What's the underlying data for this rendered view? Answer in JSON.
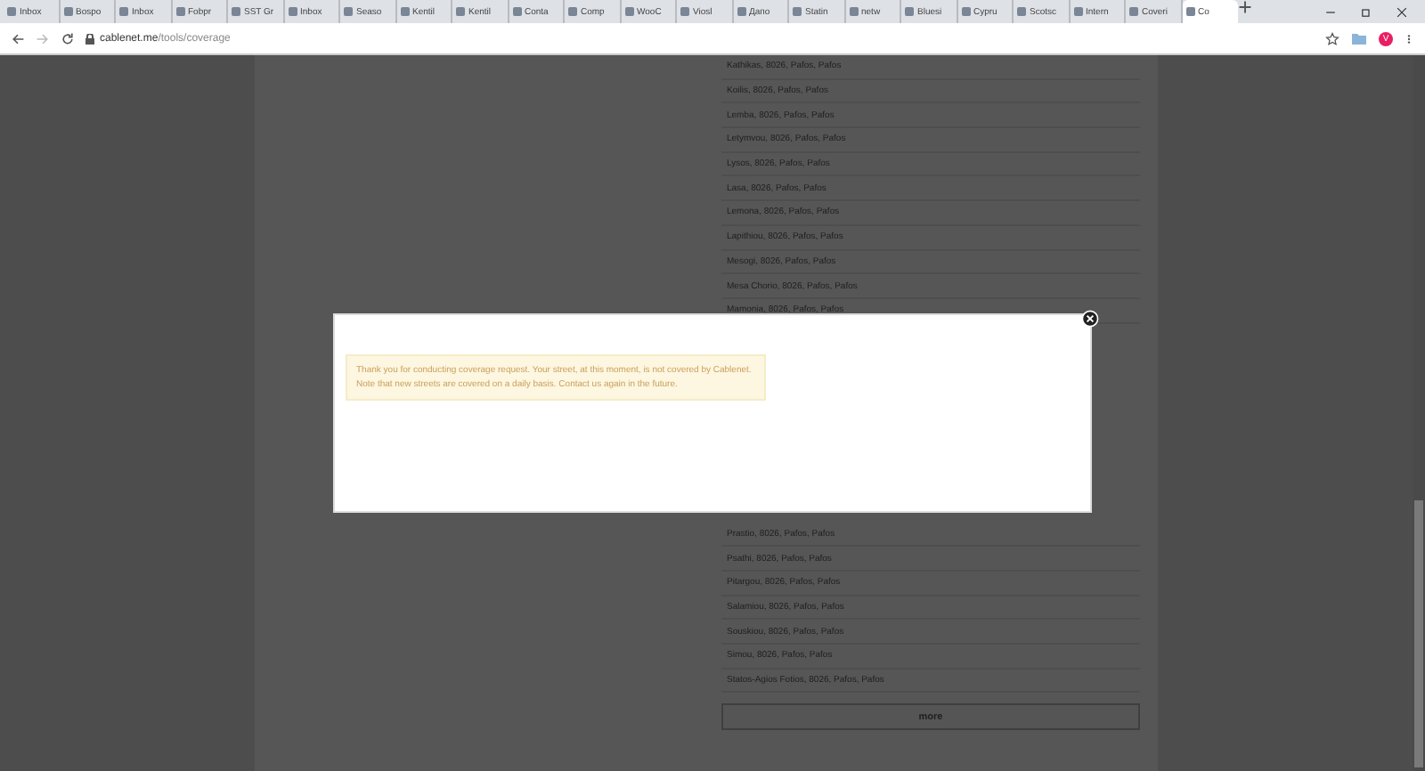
{
  "browser": {
    "tabs": [
      {
        "title": "Inbox",
        "selected": false
      },
      {
        "title": "Bospo",
        "selected": false
      },
      {
        "title": "Inbox",
        "selected": false
      },
      {
        "title": "Fobpr",
        "selected": false
      },
      {
        "title": "SST Gr",
        "selected": false
      },
      {
        "title": "Inbox",
        "selected": false
      },
      {
        "title": "Seaso",
        "selected": false
      },
      {
        "title": "Kentil",
        "selected": false
      },
      {
        "title": "Kentil",
        "selected": false
      },
      {
        "title": "Conta",
        "selected": false
      },
      {
        "title": "Comp",
        "selected": false
      },
      {
        "title": "WooC",
        "selected": false
      },
      {
        "title": "Viosl",
        "selected": false
      },
      {
        "title": "Дапо",
        "selected": false
      },
      {
        "title": "Statin",
        "selected": false
      },
      {
        "title": "netw",
        "selected": false
      },
      {
        "title": "Bluesi",
        "selected": false
      },
      {
        "title": "Cypru",
        "selected": false
      },
      {
        "title": "Scotsc",
        "selected": false
      },
      {
        "title": "Intern",
        "selected": false
      },
      {
        "title": "Coveri",
        "selected": false
      },
      {
        "title": "Co",
        "selected": true
      }
    ],
    "url_host": "cablenet.me",
    "url_path": "/tools/coverage",
    "profile_initial": "V"
  },
  "rows_above": [
    "Kathikas, 8026, Pafos, Pafos",
    "Koilis, 8026, Pafos, Pafos",
    "Lemba, 8026, Pafos, Pafos",
    "Letymvou, 8026, Pafos, Pafos",
    "Lysos, 8026, Pafos, Pafos",
    "Lasa, 8026, Pafos, Pafos",
    "Lemona, 8026, Pafos, Pafos",
    "Lapithiou, 8026, Pafos, Pafos",
    "Mesogi, 8026, Pafos, Pafos",
    "Mesa Chorio, 8026, Pafos, Pafos",
    "Mamonia, 8026, Pafos, Pafos"
  ],
  "rows_below": [
    "Prastio, 8026, Pafos, Pafos",
    "Psathi, 8026, Pafos, Pafos",
    "Pitargou, 8026, Pafos, Pafos",
    "Salamiou, 8026, Pafos, Pafos",
    "Souskiou, 8026, Pafos, Pafos",
    "Simou, 8026, Pafos, Pafos",
    "Statos-Agios Fotios, 8026, Pafos, Pafos"
  ],
  "more_button": "more",
  "modal": {
    "message": "Thank you for conducting coverage request. Your street, at this moment, is not covered by Cablenet. Note that new streets are covered on a daily basis. Contact us again in the future."
  }
}
